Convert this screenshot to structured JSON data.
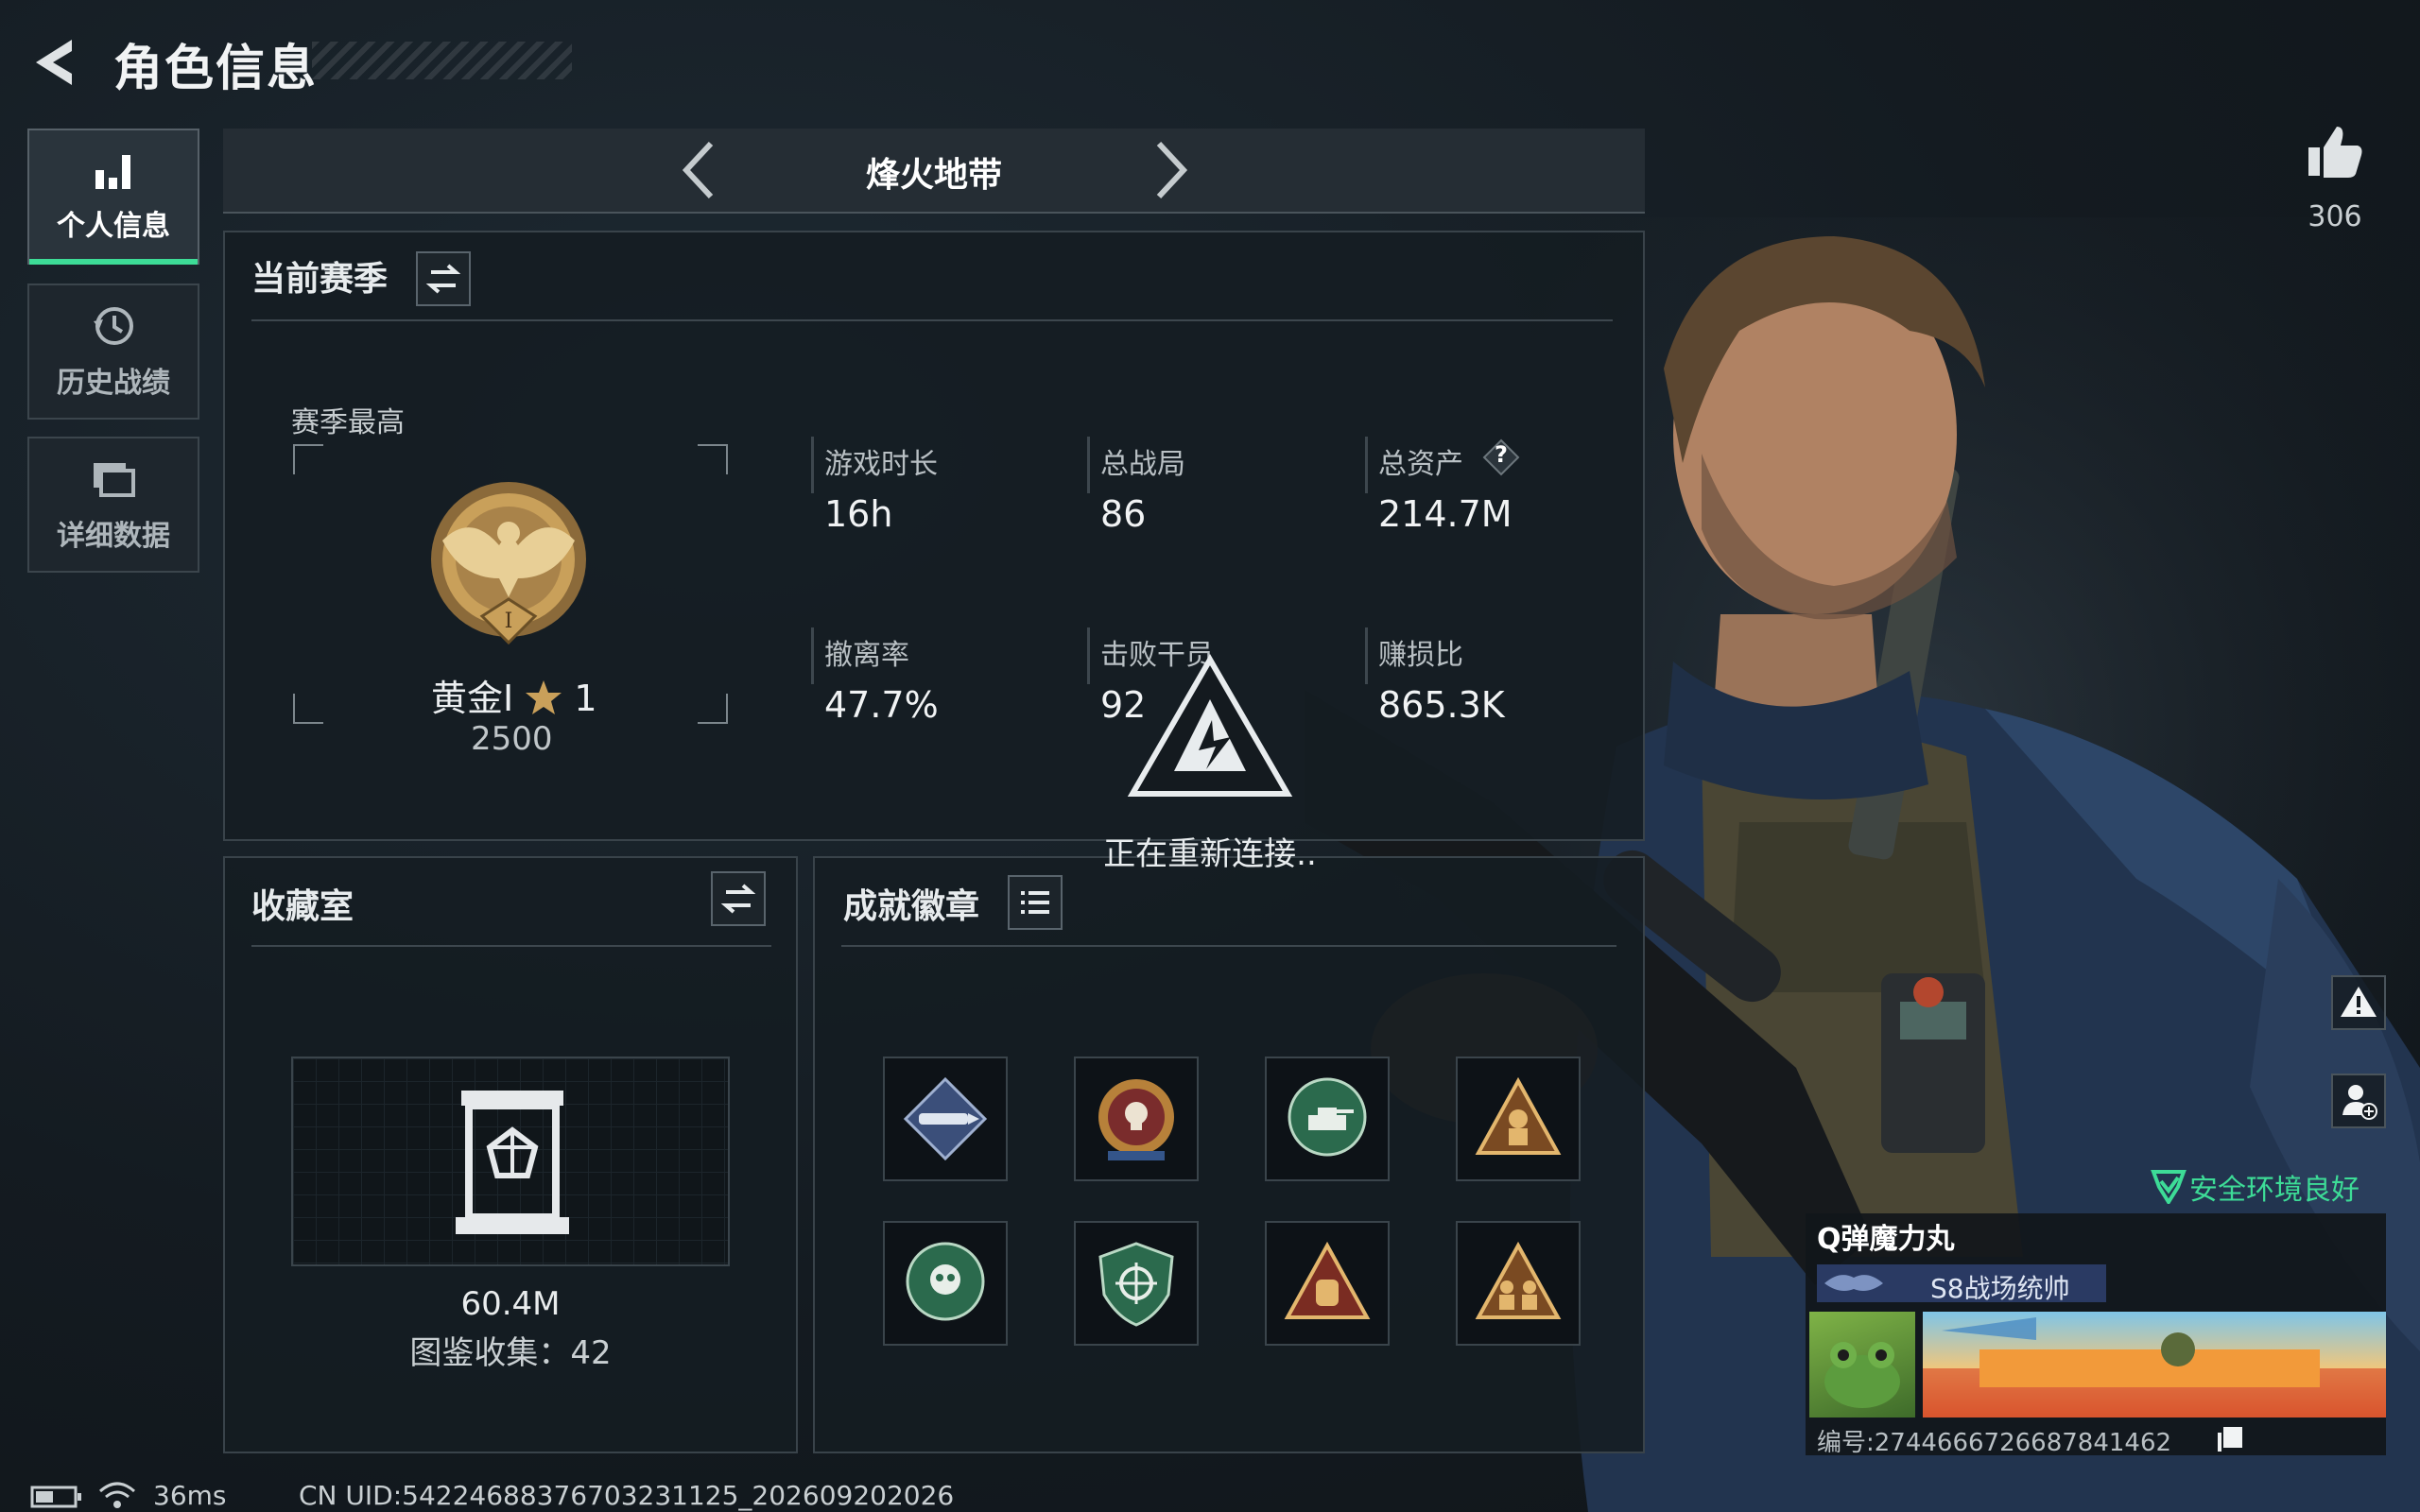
{
  "header": {
    "title": "角色信息"
  },
  "sidebar": {
    "items": [
      {
        "label": "个人信息",
        "icon": "bar-chart-icon",
        "active": true
      },
      {
        "label": "历史战绩",
        "icon": "history-clock-icon",
        "active": false
      },
      {
        "label": "详细数据",
        "icon": "folders-icon",
        "active": false
      }
    ]
  },
  "mode": {
    "title": "烽火地带"
  },
  "season": {
    "title": "当前赛季",
    "best_label": "赛季最高",
    "rank_name": "黄金I",
    "rank_stars": "1",
    "rank_score": "2500",
    "stats": [
      {
        "label": "游戏时长",
        "value": "16h"
      },
      {
        "label": "总战局",
        "value": "86"
      },
      {
        "label": "总资产",
        "value": "214.7M"
      },
      {
        "label": "撤离率",
        "value": "47.7%"
      },
      {
        "label": "击败干员",
        "value": "92"
      },
      {
        "label": "赚损比",
        "value": "865.3K"
      }
    ],
    "help_symbol": "?"
  },
  "collection": {
    "title": "收藏室",
    "value": "60.4M",
    "catalog_label": "图鉴收集：42"
  },
  "achievements": {
    "title": "成就徽章",
    "badges": [
      "rocket-badge-icon",
      "skull-star-badge-icon",
      "tank-badge-icon",
      "soldier-triangle-badge-icon",
      "skull-wreath-badge-icon",
      "crosshair-shield-badge-icon",
      "hand-triangle-badge-icon",
      "squad-triangle-badge-icon"
    ]
  },
  "reconnect": {
    "text": "正在重新连接.."
  },
  "likes": {
    "count": "306"
  },
  "safety": {
    "text": "安全环境良好"
  },
  "player": {
    "name": "Q弹魔力丸",
    "title_tag": "S8战场统帅",
    "id_text": "编号:274466672668784146​2"
  },
  "status_bar": {
    "ping": "36ms",
    "uid": "CN UID:5422468837670323​1125_202609202026"
  },
  "colors": {
    "accent_green": "#3ddc97",
    "gold": "#c9a05a",
    "panel_bg": "#151c22"
  }
}
